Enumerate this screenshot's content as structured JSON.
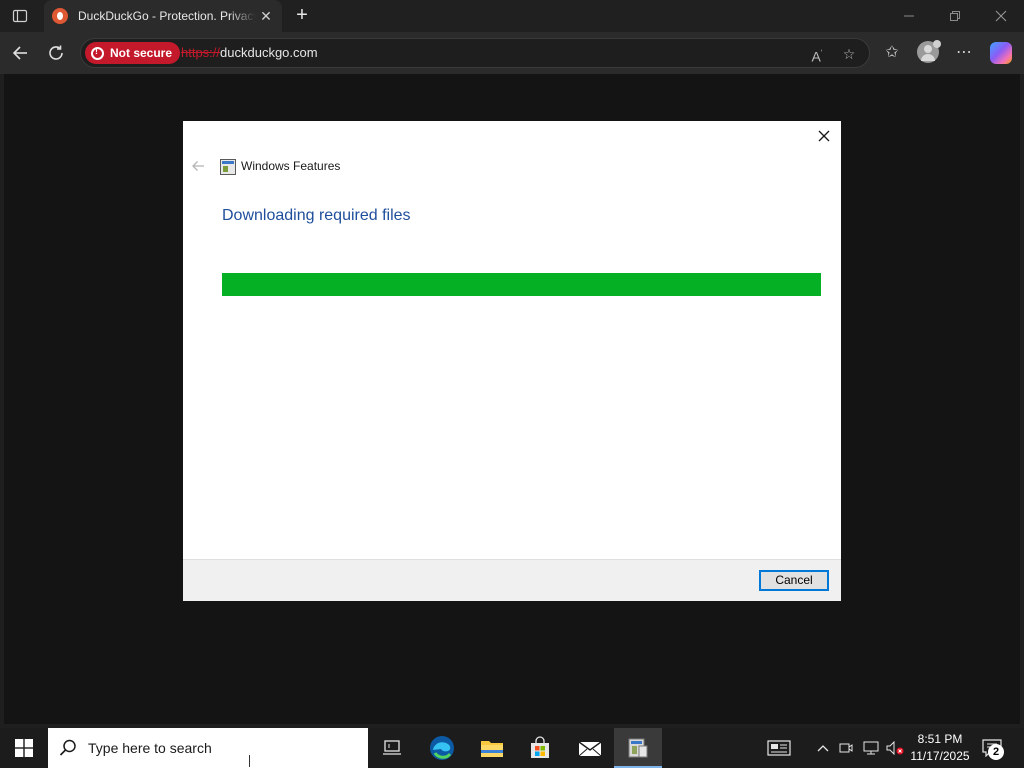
{
  "browser": {
    "tab": {
      "title": "DuckDuckGo - Protection. Privacy. Peace of mind."
    },
    "address": {
      "security_label": "Not secure",
      "url_scheme": "https://",
      "url_host": "duckduckgo.com"
    }
  },
  "main": {
    "dialog": {
      "title": "Windows Features",
      "heading": "Downloading required files",
      "progress_percent": 100,
      "cancel_label": "Cancel"
    }
  },
  "taskbar": {
    "search_placeholder": "Type here to search",
    "time": "8:51 PM",
    "date": "11/17/2025",
    "notification_count": "2"
  },
  "colors": {
    "progress_fill": "#06b025",
    "not_secure_badge": "#c4192b",
    "heading_blue": "#1f4e9c",
    "focus_border": "#0078d7"
  },
  "icons": {
    "titlebar": [
      "tab-actions-icon",
      "duckduckgo-favicon",
      "tab-close-icon",
      "new-tab-icon",
      "minimize-icon",
      "restore-icon",
      "window-close-icon"
    ],
    "navbar": [
      "back-icon",
      "refresh-icon",
      "shield-warning-icon",
      "read-aloud-icon",
      "favorite-star-icon",
      "favorites-icon",
      "profile-avatar-icon",
      "more-icon",
      "copilot-icon"
    ],
    "taskbar": [
      "windows-start-icon",
      "search-icon",
      "task-view-icon",
      "edge-icon",
      "file-explorer-icon",
      "store-icon",
      "mail-icon",
      "windows-features-icon",
      "news-widget-icon",
      "show-hidden-icons-icon",
      "meet-now-icon",
      "network-icon",
      "volume-muted-icon",
      "notification-icon"
    ]
  }
}
